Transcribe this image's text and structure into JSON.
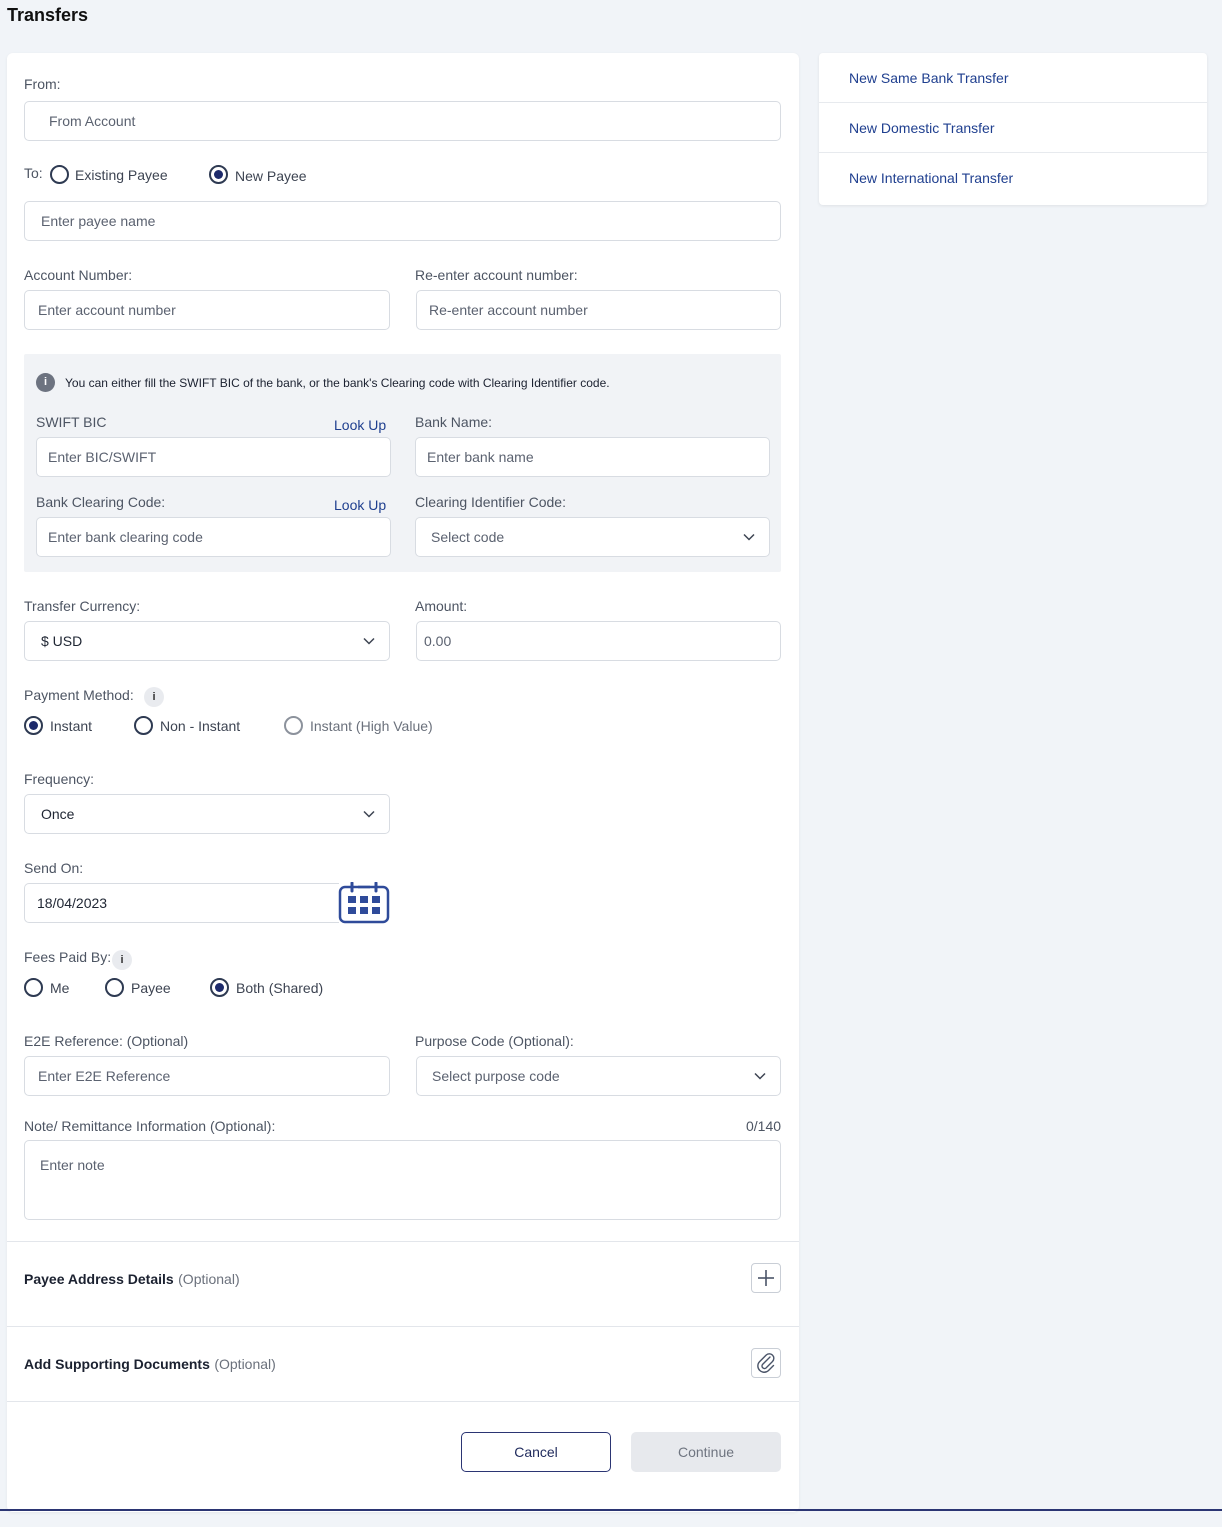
{
  "page": {
    "title": "Transfers"
  },
  "sidebar": {
    "items": [
      {
        "label": "New Same Bank Transfer"
      },
      {
        "label": "New Domestic Transfer"
      },
      {
        "label": "New International Transfer"
      }
    ]
  },
  "form": {
    "from": {
      "label": "From:",
      "placeholder": "From Account"
    },
    "to": {
      "label": "To:",
      "options": [
        {
          "label": "Existing Payee",
          "selected": false
        },
        {
          "label": "New Payee",
          "selected": true
        }
      ],
      "payee_placeholder": "Enter payee name"
    },
    "account_number": {
      "label": "Account Number:",
      "placeholder": "Enter account number"
    },
    "reenter_account": {
      "label": "Re-enter account number:",
      "placeholder": "Re-enter account number"
    },
    "bank_info": {
      "notice": "You can either fill the SWIFT BIC of the bank, or the bank's Clearing code with Clearing Identifier code.",
      "swift": {
        "label": "SWIFT BIC",
        "lookup": "Look Up",
        "placeholder": "Enter BIC/SWIFT"
      },
      "bank_name": {
        "label": "Bank Name:",
        "placeholder": "Enter bank name"
      },
      "clearing_code": {
        "label": "Bank Clearing Code:",
        "lookup": "Look Up",
        "placeholder": "Enter bank clearing code"
      },
      "clearing_identifier": {
        "label": "Clearing Identifier Code:",
        "placeholder": "Select code"
      }
    },
    "currency": {
      "label": "Transfer Currency:",
      "value": "$ USD"
    },
    "amount": {
      "label": "Amount:",
      "placeholder": "0.00"
    },
    "payment_method": {
      "label": "Payment Method:",
      "info": "i",
      "options": [
        {
          "label": "Instant",
          "selected": true
        },
        {
          "label": "Non - Instant",
          "selected": false
        },
        {
          "label": "Instant (High Value)",
          "selected": false,
          "disabled": true
        }
      ]
    },
    "frequency": {
      "label": "Frequency:",
      "value": "Once"
    },
    "send_on": {
      "label": "Send On:",
      "value": "18/04/2023",
      "icon": "calendar-icon"
    },
    "fees": {
      "label": "Fees Paid By:",
      "info": "i",
      "options": [
        {
          "label": "Me",
          "selected": false
        },
        {
          "label": "Payee",
          "selected": false
        },
        {
          "label": "Both (Shared)",
          "selected": true
        }
      ]
    },
    "e2e": {
      "label": "E2E Reference: (Optional)",
      "placeholder": "Enter E2E Reference"
    },
    "purpose": {
      "label": "Purpose Code (Optional):",
      "placeholder": "Select purpose code"
    },
    "note": {
      "label": "Note/ Remittance Information (Optional):",
      "counter": "0/140",
      "placeholder": "Enter note"
    }
  },
  "sections": {
    "payee_address": {
      "title": "Payee Address Details",
      "optional": "(Optional)",
      "icon": "plus-icon"
    },
    "documents": {
      "title": "Add Supporting Documents",
      "optional": "(Optional)",
      "icon": "paperclip-icon"
    }
  },
  "actions": {
    "cancel": "Cancel",
    "continue": "Continue"
  },
  "colors": {
    "accent": "#1d2a6b",
    "link": "#1f3f8f",
    "background": "#f1f4f8"
  }
}
